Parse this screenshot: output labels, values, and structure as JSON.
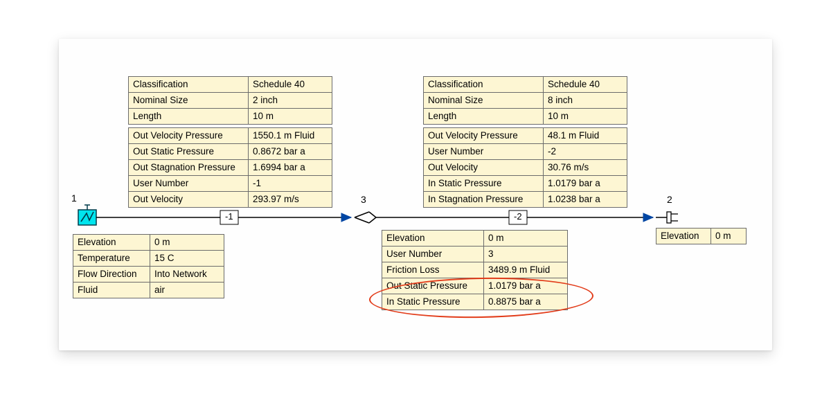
{
  "pipe1": {
    "rows": [
      {
        "k": "Classification",
        "v": "Schedule 40"
      },
      {
        "k": "Nominal Size",
        "v": "2 inch"
      },
      {
        "k": "Length",
        "v": "10 m"
      }
    ],
    "rows2": [
      {
        "k": "Out Velocity Pressure",
        "v": "1550.1 m Fluid"
      },
      {
        "k": "Out Static Pressure",
        "v": "0.8672 bar a"
      },
      {
        "k": "Out Stagnation Pressure",
        "v": "1.6994 bar a"
      },
      {
        "k": "User Number",
        "v": "-1"
      },
      {
        "k": "Out Velocity",
        "v": "293.97 m/s"
      }
    ],
    "tag": "-1"
  },
  "pipe2": {
    "rows": [
      {
        "k": "Classification",
        "v": "Schedule 40"
      },
      {
        "k": "Nominal Size",
        "v": "8 inch"
      },
      {
        "k": "Length",
        "v": "10 m"
      }
    ],
    "rows2": [
      {
        "k": "Out Velocity Pressure",
        "v": "48.1 m Fluid"
      },
      {
        "k": "User Number",
        "v": "-2"
      },
      {
        "k": "Out Velocity",
        "v": "30.76 m/s"
      },
      {
        "k": "In Static Pressure",
        "v": "1.0179 bar a"
      },
      {
        "k": "In Stagnation Pressure",
        "v": "1.0238 bar a"
      }
    ],
    "tag": "-2"
  },
  "node1": {
    "label": "1",
    "rows": [
      {
        "k": "Elevation",
        "v": "0 m"
      },
      {
        "k": "Temperature",
        "v": "15 C"
      },
      {
        "k": "Flow Direction",
        "v": "Into Network"
      },
      {
        "k": "Fluid",
        "v": "air"
      }
    ]
  },
  "node3": {
    "label": "3",
    "rows": [
      {
        "k": "Elevation",
        "v": "0 m"
      },
      {
        "k": "User Number",
        "v": "3"
      },
      {
        "k": "Friction Loss",
        "v": "3489.9 m Fluid"
      },
      {
        "k": "Out Static Pressure",
        "v": "1.0179 bar a"
      },
      {
        "k": "In Static Pressure",
        "v": "0.8875 bar a"
      }
    ]
  },
  "node2": {
    "label": "2",
    "rows": [
      {
        "k": "Elevation",
        "v": "0 m"
      }
    ]
  }
}
